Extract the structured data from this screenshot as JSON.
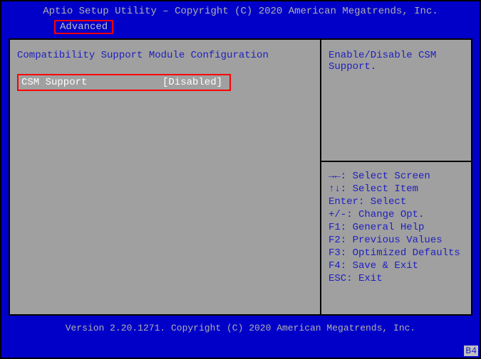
{
  "header": {
    "title": "Aptio Setup Utility – Copyright (C) 2020 American Megatrends, Inc."
  },
  "tabs": {
    "advanced": "Advanced"
  },
  "main": {
    "section_title": "Compatibility Support Module Configuration",
    "csm_label": "CSM Support",
    "csm_value": "[Disabled]"
  },
  "help": {
    "text": "Enable/Disable CSM Support."
  },
  "hints": {
    "select_screen": "→←: Select Screen",
    "select_item": "↑↓: Select Item",
    "select": "Enter: Select",
    "change_opt": "+/-: Change Opt.",
    "general_help": "F1: General Help",
    "previous_values": "F2: Previous Values",
    "optimized_defaults": "F3: Optimized Defaults",
    "save_exit": "F4: Save & Exit",
    "exit": "ESC: Exit"
  },
  "footer": {
    "version": "Version 2.20.1271. Copyright (C) 2020 American Megatrends, Inc."
  },
  "badge": "B4"
}
